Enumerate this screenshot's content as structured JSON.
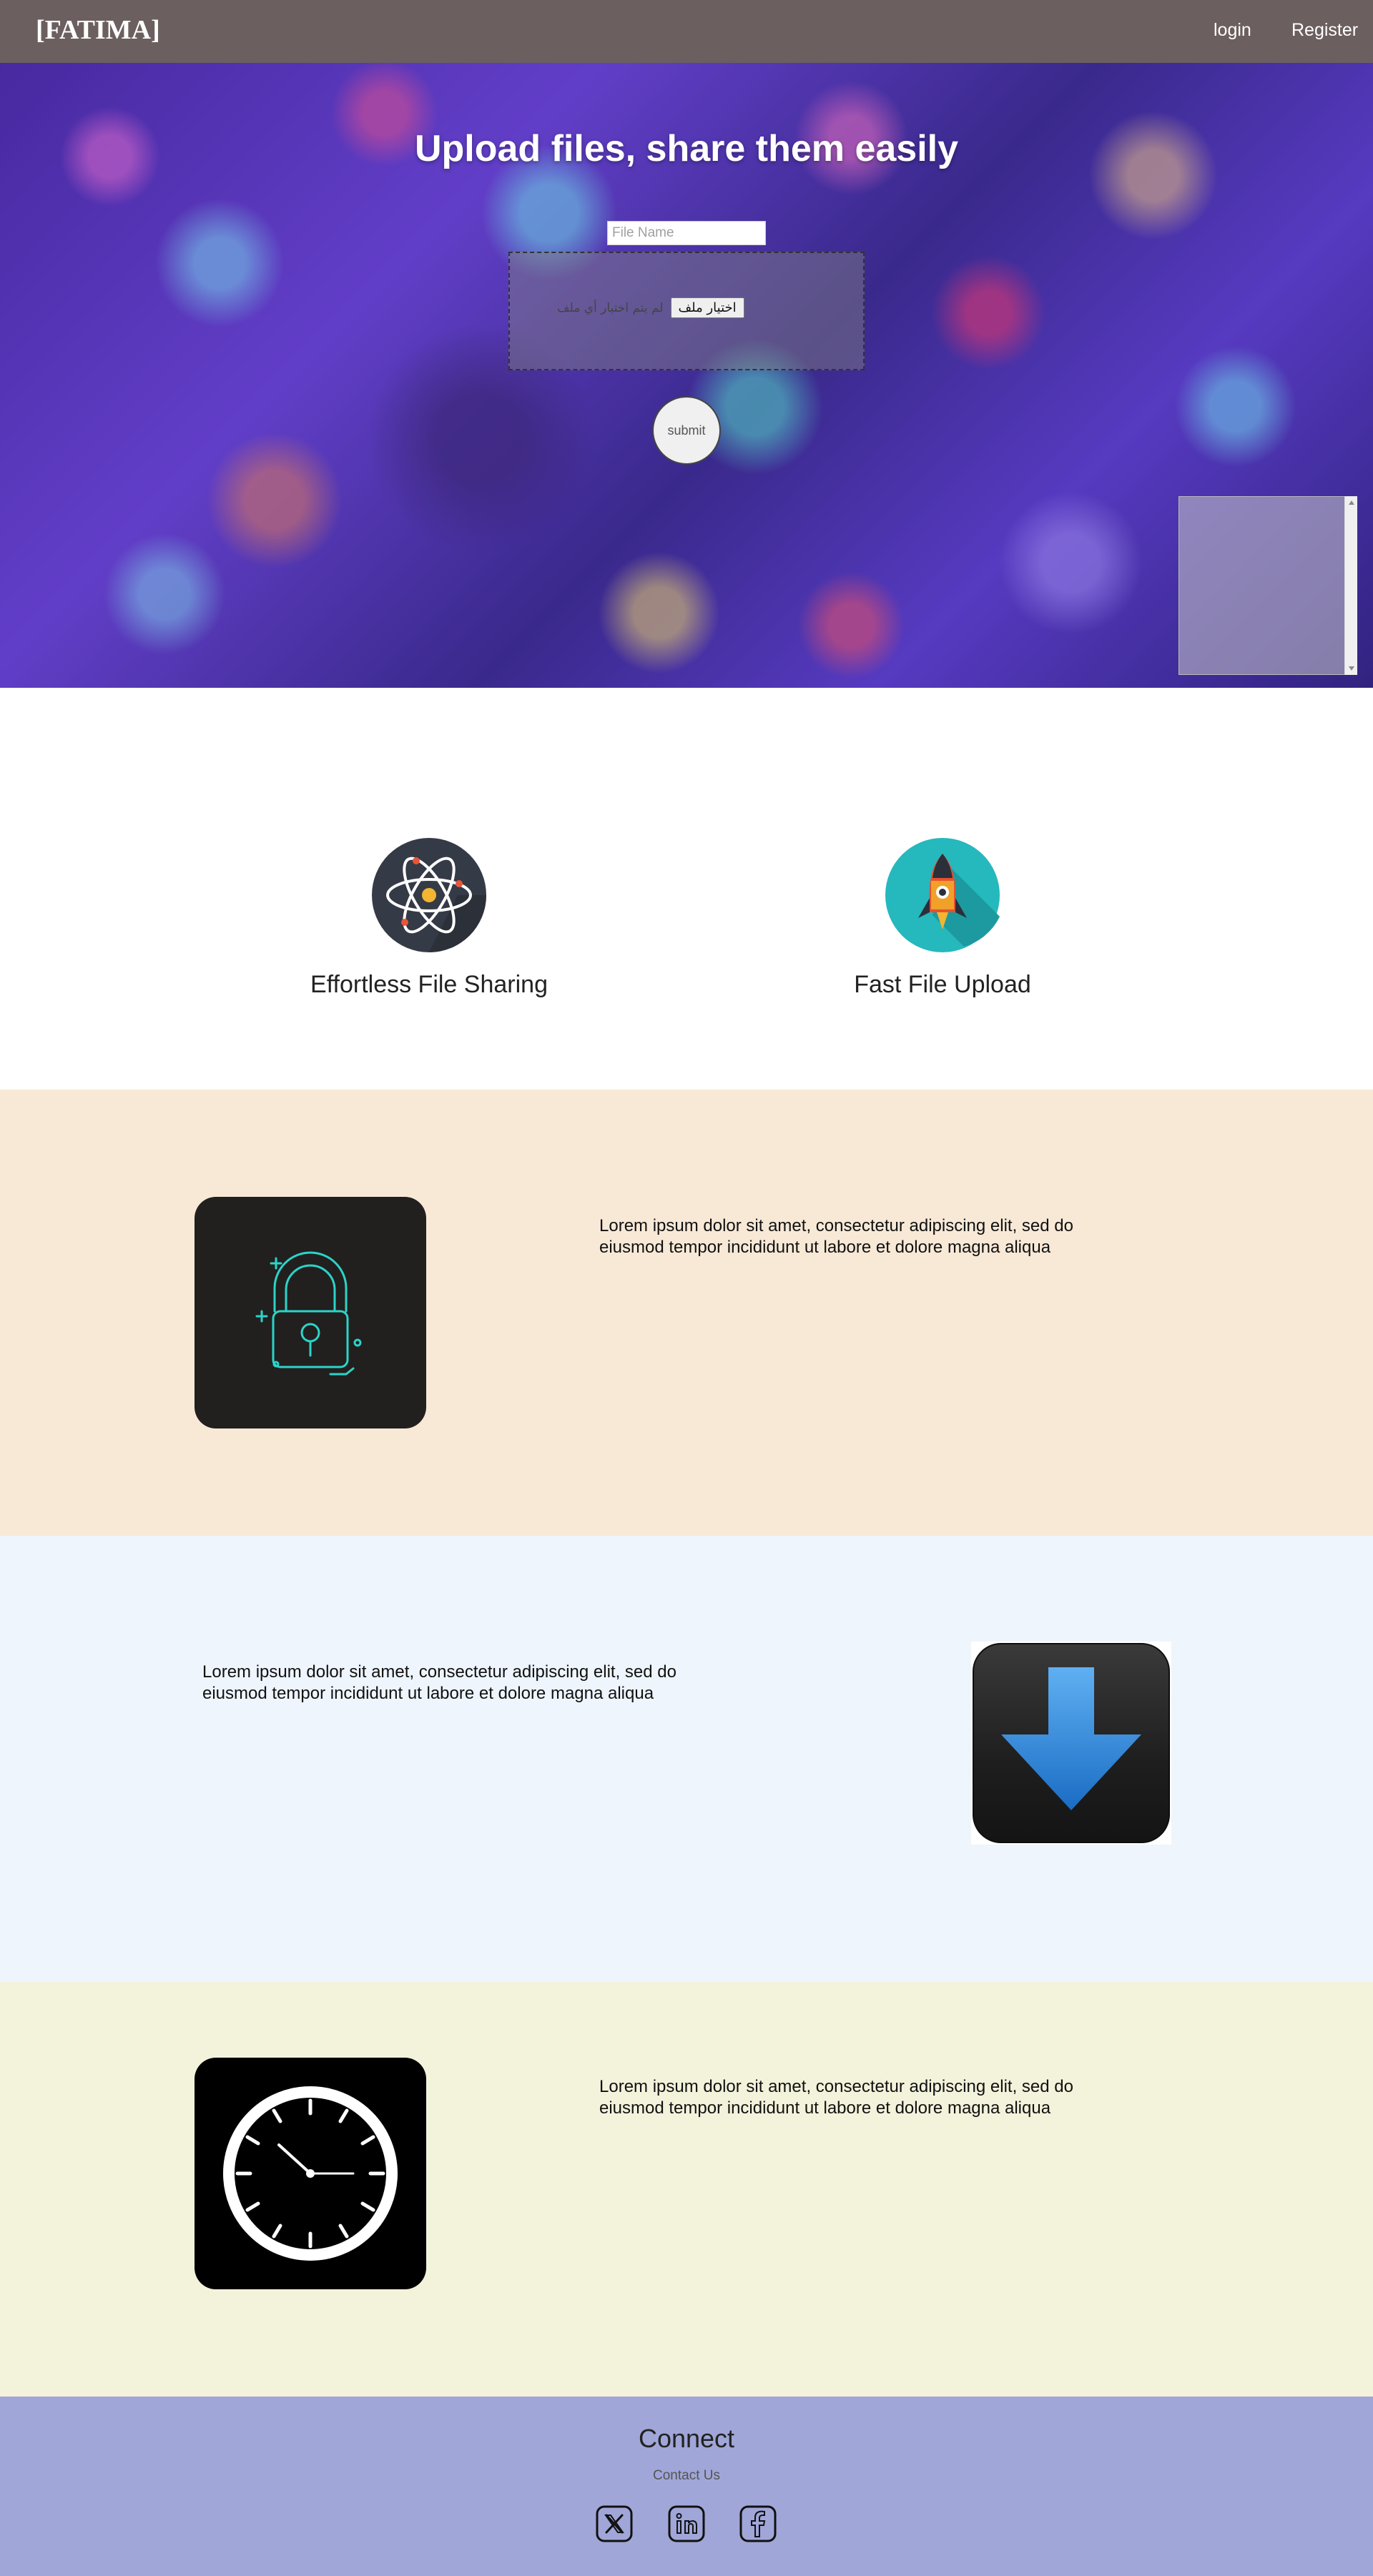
{
  "header": {
    "brand": "[FATIMA]",
    "nav": [
      {
        "label": "login"
      },
      {
        "label": "Register"
      }
    ]
  },
  "hero": {
    "title": "Upload files, share them easily",
    "file_name_placeholder": "File Name",
    "file_input": {
      "button_label": "اختيار ملف",
      "status": "لم يتم اختيار أي ملف"
    },
    "submit_label": "submit"
  },
  "features": [
    {
      "title": "Effortless File Sharing",
      "icon": "atom-icon"
    },
    {
      "title": "Fast File Upload",
      "icon": "rocket-icon"
    }
  ],
  "info_sections": [
    {
      "text": "Lorem ipsum dolor sit amet, consectetur adipiscing elit, sed do eiusmod tempor incididunt ut labore et dolore magna aliqua",
      "icon": "lock-icon",
      "background": "#f8e9d7"
    },
    {
      "text": "Lorem ipsum dolor sit amet, consectetur adipiscing elit, sed do eiusmod tempor incididunt ut labore et dolore magna aliqua",
      "icon": "download-arrow-icon",
      "background": "#eef5fd"
    },
    {
      "text": "Lorem ipsum dolor sit amet, consectetur adipiscing elit, sed do eiusmod tempor incididunt ut labore et dolore magna aliqua",
      "icon": "clock-icon",
      "background": "#f3f2db"
    }
  ],
  "footer": {
    "title": "Connect",
    "contact": "Contact Us",
    "social": [
      "x-icon",
      "linkedin-icon",
      "facebook-icon"
    ],
    "background": "#a0a6d8"
  },
  "colors": {
    "header_bg": "#6c5f5f",
    "accent_teal": "#2bd4c8",
    "download_blue": "#2f86d8"
  }
}
